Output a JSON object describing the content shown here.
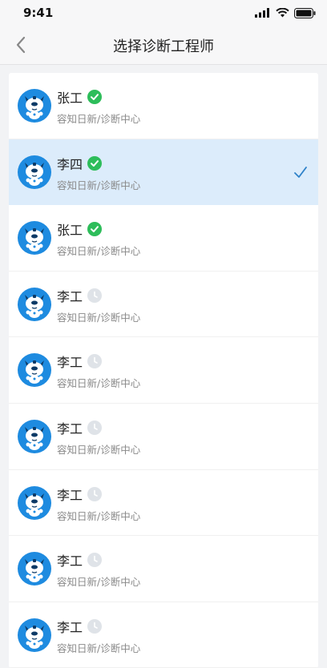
{
  "status_bar": {
    "time": "9:41"
  },
  "nav": {
    "title": "选择诊断工程师"
  },
  "engineers": [
    {
      "name": "张工",
      "org": "容知日新/诊断中心",
      "status": "online",
      "selected": false
    },
    {
      "name": "李四",
      "org": "容知日新/诊断中心",
      "status": "online",
      "selected": true
    },
    {
      "name": "张工",
      "org": "容知日新/诊断中心",
      "status": "online",
      "selected": false
    },
    {
      "name": "李工",
      "org": "容知日新/诊断中心",
      "status": "pending",
      "selected": false
    },
    {
      "name": "李工",
      "org": "容知日新/诊断中心",
      "status": "pending",
      "selected": false
    },
    {
      "name": "李工",
      "org": "容知日新/诊断中心",
      "status": "pending",
      "selected": false
    },
    {
      "name": "李工",
      "org": "容知日新/诊断中心",
      "status": "pending",
      "selected": false
    },
    {
      "name": "李工",
      "org": "容知日新/诊断中心",
      "status": "pending",
      "selected": false
    },
    {
      "name": "李工",
      "org": "容知日新/诊断中心",
      "status": "pending",
      "selected": false
    }
  ],
  "icons": {
    "online": "check-circle-icon",
    "pending": "clock-icon",
    "selected": "checkmark-icon",
    "avatar": "robot-dog-avatar"
  },
  "colors": {
    "online_badge": "#2dbd5a",
    "pending_badge": "#dfe3e8",
    "selected_row": "#dcecfb",
    "checkmark": "#2f82c9",
    "avatar_bg": "#1e8be0"
  }
}
